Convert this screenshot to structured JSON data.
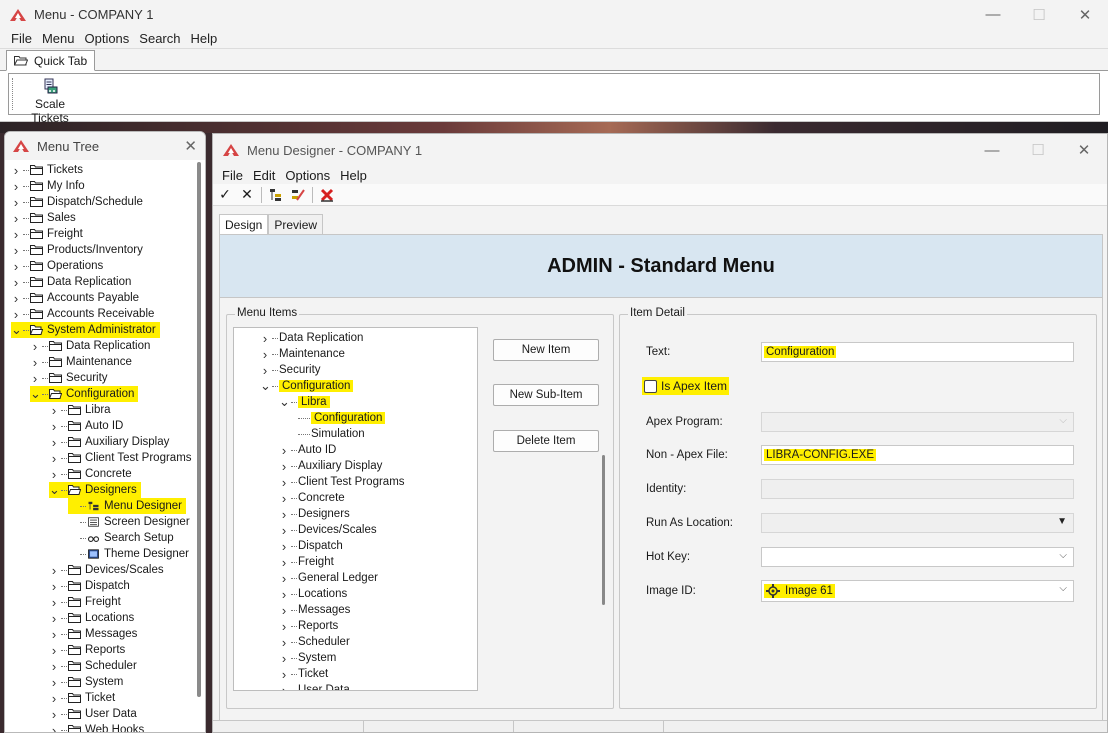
{
  "main_window": {
    "title": "Menu - COMPANY 1",
    "menu": [
      "File",
      "Menu",
      "Options",
      "Search",
      "Help"
    ],
    "quick_tab": "Quick Tab",
    "toolbox_button": "Scale Tickets",
    "controls": {
      "minimize": "—",
      "maximize": "☐",
      "close": "✕"
    }
  },
  "menu_tree": {
    "title": "Menu Tree",
    "close": "✕",
    "items": [
      {
        "label": "Tickets",
        "level": 0,
        "chev": ">"
      },
      {
        "label": "My Info",
        "level": 0,
        "chev": ">"
      },
      {
        "label": "Dispatch/Schedule",
        "level": 0,
        "chev": ">"
      },
      {
        "label": "Sales",
        "level": 0,
        "chev": ">"
      },
      {
        "label": "Freight",
        "level": 0,
        "chev": ">"
      },
      {
        "label": "Products/Inventory",
        "level": 0,
        "chev": ">"
      },
      {
        "label": "Operations",
        "level": 0,
        "chev": ">"
      },
      {
        "label": "Data Replication",
        "level": 0,
        "chev": ">"
      },
      {
        "label": "Accounts Payable",
        "level": 0,
        "chev": ">"
      },
      {
        "label": "Accounts Receivable",
        "level": 0,
        "chev": ">"
      },
      {
        "label": "System Administrator",
        "level": 0,
        "chev": "v",
        "open": true,
        "hl": true
      },
      {
        "label": "Data Replication",
        "level": 1,
        "chev": ">"
      },
      {
        "label": "Maintenance",
        "level": 1,
        "chev": ">"
      },
      {
        "label": "Security",
        "level": 1,
        "chev": ">"
      },
      {
        "label": "Configuration",
        "level": 1,
        "chev": "v",
        "open": true,
        "hl": true
      },
      {
        "label": "Libra",
        "level": 2,
        "chev": ">"
      },
      {
        "label": "Auto ID",
        "level": 2,
        "chev": ">"
      },
      {
        "label": "Auxiliary Display",
        "level": 2,
        "chev": ">"
      },
      {
        "label": "Client Test Programs",
        "level": 2,
        "chev": ">"
      },
      {
        "label": "Concrete",
        "level": 2,
        "chev": ">"
      },
      {
        "label": "Designers",
        "level": 2,
        "chev": "v",
        "open": true,
        "hl": true
      },
      {
        "label": "Menu Designer",
        "level": 3,
        "icon": "menu-designer-icon",
        "hl": true
      },
      {
        "label": "Screen Designer",
        "level": 3,
        "icon": "screen-designer-icon"
      },
      {
        "label": "Search Setup",
        "level": 3,
        "icon": "binoculars-icon"
      },
      {
        "label": "Theme Designer",
        "level": 3,
        "icon": "theme-designer-icon"
      },
      {
        "label": "Devices/Scales",
        "level": 2,
        "chev": ">"
      },
      {
        "label": "Dispatch",
        "level": 2,
        "chev": ">"
      },
      {
        "label": "Freight",
        "level": 2,
        "chev": ">"
      },
      {
        "label": "Locations",
        "level": 2,
        "chev": ">"
      },
      {
        "label": "Messages",
        "level": 2,
        "chev": ">"
      },
      {
        "label": "Reports",
        "level": 2,
        "chev": ">"
      },
      {
        "label": "Scheduler",
        "level": 2,
        "chev": ">"
      },
      {
        "label": "System",
        "level": 2,
        "chev": ">"
      },
      {
        "label": "Ticket",
        "level": 2,
        "chev": ">"
      },
      {
        "label": "User Data",
        "level": 2,
        "chev": ">"
      },
      {
        "label": "Web Hooks",
        "level": 2,
        "chev": ">"
      }
    ]
  },
  "designer": {
    "title": "Menu Designer - COMPANY 1",
    "menu": [
      "File",
      "Edit",
      "Options",
      "Help"
    ],
    "tabs": [
      "Design",
      "Preview"
    ],
    "banner": "ADMIN - Standard Menu",
    "menu_items_label": "Menu Items",
    "item_detail_label": "Item Detail",
    "items": [
      {
        "label": "Data Replication",
        "level": 0,
        "chev": ">"
      },
      {
        "label": "Maintenance",
        "level": 0,
        "chev": ">"
      },
      {
        "label": "Security",
        "level": 0,
        "chev": ">"
      },
      {
        "label": "Configuration",
        "level": 0,
        "chev": "v",
        "hl": true
      },
      {
        "label": "Libra",
        "level": 1,
        "chev": "v",
        "hl": true
      },
      {
        "label": "Configuration",
        "level": 2,
        "hl": true,
        "leaf": true
      },
      {
        "label": "Simulation",
        "level": 2,
        "leaf": true
      },
      {
        "label": "Auto ID",
        "level": 1,
        "chev": ">"
      },
      {
        "label": "Auxiliary Display",
        "level": 1,
        "chev": ">"
      },
      {
        "label": "Client Test Programs",
        "level": 1,
        "chev": ">"
      },
      {
        "label": "Concrete",
        "level": 1,
        "chev": ">"
      },
      {
        "label": "Designers",
        "level": 1,
        "chev": ">"
      },
      {
        "label": "Devices/Scales",
        "level": 1,
        "chev": ">"
      },
      {
        "label": "Dispatch",
        "level": 1,
        "chev": ">"
      },
      {
        "label": "Freight",
        "level": 1,
        "chev": ">"
      },
      {
        "label": "General Ledger",
        "level": 1,
        "chev": ">"
      },
      {
        "label": "Locations",
        "level": 1,
        "chev": ">"
      },
      {
        "label": "Messages",
        "level": 1,
        "chev": ">"
      },
      {
        "label": "Reports",
        "level": 1,
        "chev": ">"
      },
      {
        "label": "Scheduler",
        "level": 1,
        "chev": ">"
      },
      {
        "label": "System",
        "level": 1,
        "chev": ">"
      },
      {
        "label": "Ticket",
        "level": 1,
        "chev": ">"
      },
      {
        "label": "User Data",
        "level": 1,
        "chev": ">"
      }
    ],
    "buttons": {
      "new_item": "New Item",
      "new_sub_item": "New Sub-Item",
      "delete_item": "Delete Item"
    },
    "detail": {
      "text_label": "Text:",
      "text_value": "Configuration",
      "apex_label": "Is Apex Item",
      "apex_program_label": "Apex Program:",
      "non_apex_label": "Non - Apex File:",
      "non_apex_value": "LIBRA-CONFIG.EXE",
      "identity_label": "Identity:",
      "run_as_label": "Run As Location:",
      "hot_key_label": "Hot Key:",
      "image_id_label": "Image ID:",
      "image_id_value": "Image 61"
    }
  },
  "colors": {
    "highlight": "#ffef00",
    "banner": "#d8e6f1",
    "logo": "#d64545"
  }
}
